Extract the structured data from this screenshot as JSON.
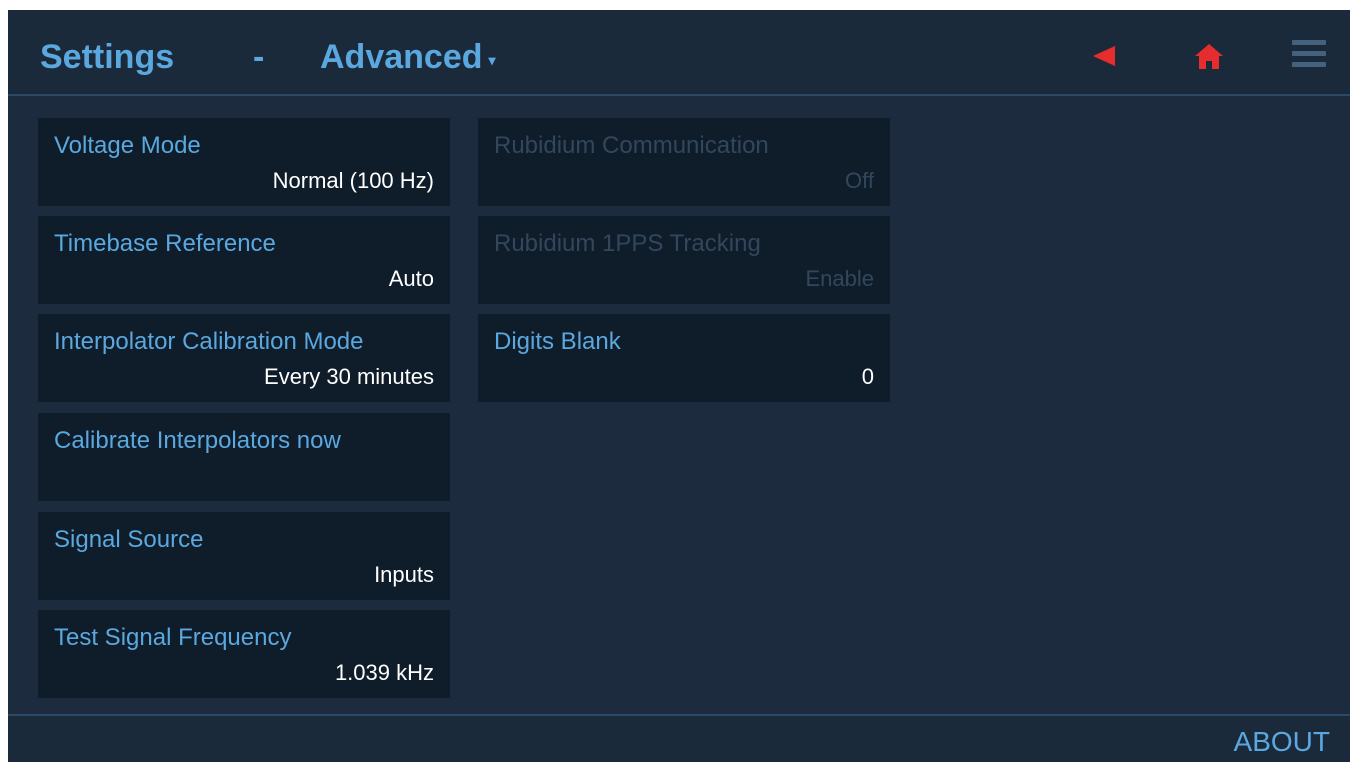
{
  "header": {
    "title": "Settings",
    "separator": "-",
    "subtitle": "Advanced",
    "subtitle_caret": "▾"
  },
  "tiles": [
    {
      "label": "Voltage Mode",
      "value": "Normal (100 Hz)",
      "enabled": true
    },
    {
      "label": "Timebase Reference",
      "value": "Auto",
      "enabled": true
    },
    {
      "label": "Interpolator Calibration Mode",
      "value": "Every 30 minutes",
      "enabled": true
    },
    {
      "label": "Calibrate Interpolators now",
      "value": "",
      "enabled": true
    },
    {
      "label": "Signal Source",
      "value": "Inputs",
      "enabled": true
    },
    {
      "label": "Test Signal Frequency",
      "value": "1.039 kHz",
      "enabled": true
    },
    {
      "label": "Rubidium Communication",
      "value": "Off",
      "enabled": false
    },
    {
      "label": "Rubidium 1PPS Tracking",
      "value": "Enable",
      "enabled": false
    },
    {
      "label": "Digits Blank",
      "value": "0",
      "enabled": true
    }
  ],
  "footer": {
    "about_label": "ABOUT"
  },
  "icons": {
    "back": "back-arrow-icon",
    "home": "home-icon",
    "menu": "hamburger-menu-icon"
  },
  "colors": {
    "accent": "#5aa8df",
    "alert": "#e52d2d",
    "tile_bg": "#0f1c2a",
    "screen_bg": "#1c2b3d"
  }
}
